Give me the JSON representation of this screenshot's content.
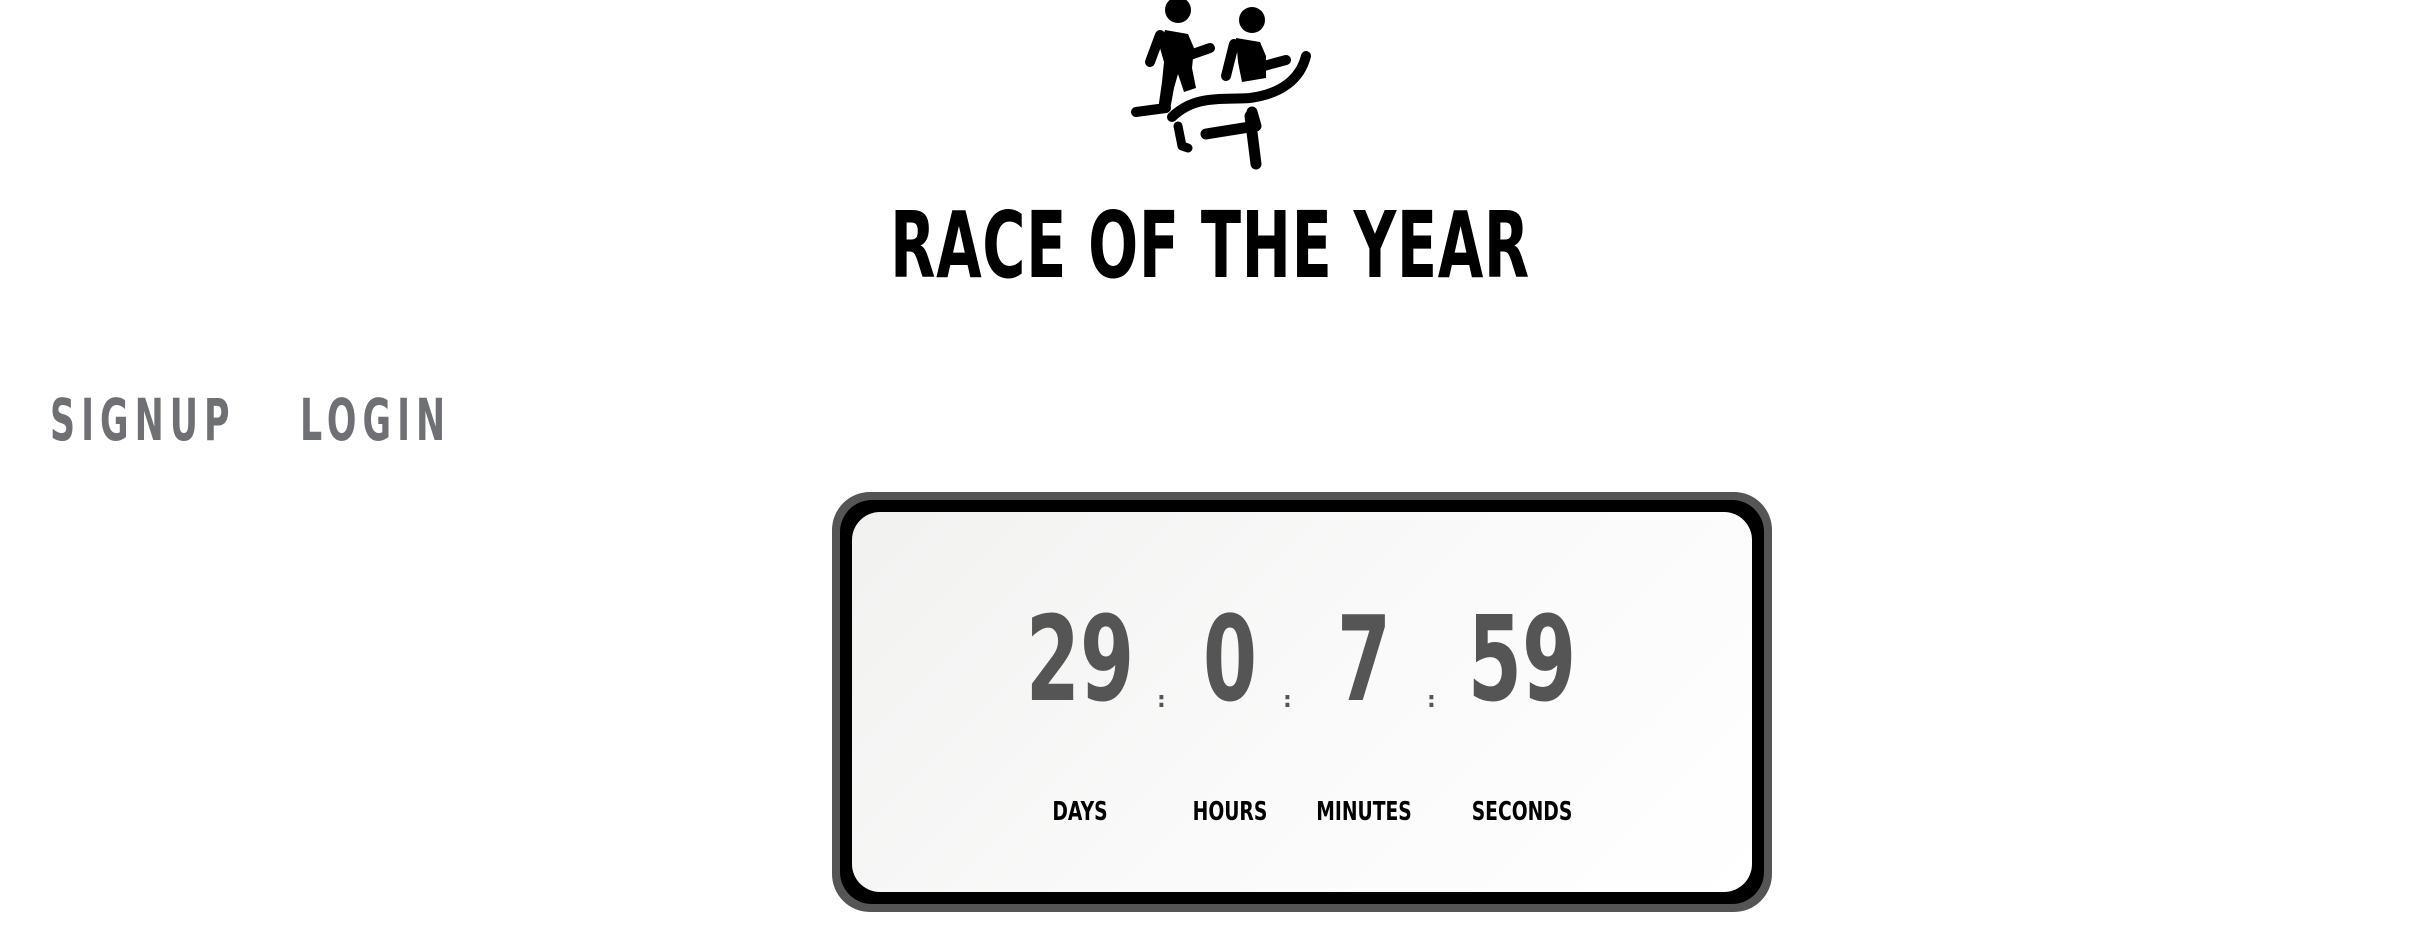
{
  "logo": {
    "icon": "runners-logo-icon"
  },
  "header": {
    "title": "RACE OF THE YEAR"
  },
  "nav": {
    "signup_label": "SIGNUP",
    "login_label": "LOGIN"
  },
  "countdown": {
    "days": {
      "value": "29",
      "label": "DAYS"
    },
    "hours": {
      "value": "0",
      "label": "HOURS"
    },
    "minutes": {
      "value": "7",
      "label": "MINUTES"
    },
    "seconds": {
      "value": "59",
      "label": "SECONDS"
    },
    "separator": ":"
  },
  "colors": {
    "title": "#000000",
    "nav": "#6f7073",
    "digits": "#555555",
    "frame": "#555555"
  }
}
